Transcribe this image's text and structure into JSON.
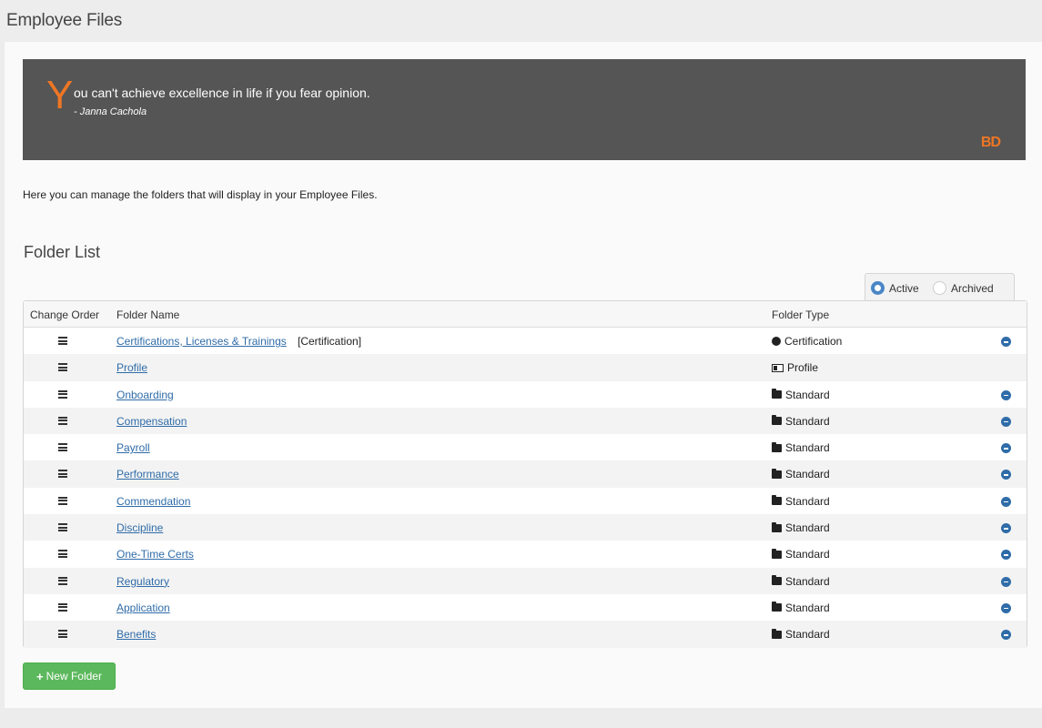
{
  "page": {
    "title": "Employee Files"
  },
  "quote": {
    "first_letter": "Y",
    "text": "ou can't achieve excellence in life if you fear opinion.",
    "author": "- Janna Cachola",
    "logo": "BD"
  },
  "intro": "Here you can manage the folders that will display in your Employee Files.",
  "section_title": "Folder List",
  "filter": {
    "active_label": "Active",
    "archived_label": "Archived",
    "selected": "Active"
  },
  "table": {
    "headers": {
      "order": "Change Order",
      "name": "Folder Name",
      "type": "Folder Type"
    },
    "rows": [
      {
        "name": "Certifications, Licenses & Trainings",
        "suffix": "[Certification]",
        "type": "Certification",
        "icon": "certificate-icon",
        "removable": true
      },
      {
        "name": "Profile",
        "suffix": "",
        "type": "Profile",
        "icon": "id-card-icon",
        "removable": false
      },
      {
        "name": "Onboarding",
        "suffix": "",
        "type": "Standard",
        "icon": "folder-icon",
        "removable": true
      },
      {
        "name": "Compensation",
        "suffix": "",
        "type": "Standard",
        "icon": "folder-icon",
        "removable": true
      },
      {
        "name": "Payroll",
        "suffix": "",
        "type": "Standard",
        "icon": "folder-icon",
        "removable": true
      },
      {
        "name": "Performance",
        "suffix": "",
        "type": "Standard",
        "icon": "folder-icon",
        "removable": true
      },
      {
        "name": "Commendation",
        "suffix": "",
        "type": "Standard",
        "icon": "folder-icon",
        "removable": true
      },
      {
        "name": "Discipline",
        "suffix": "",
        "type": "Standard",
        "icon": "folder-icon",
        "removable": true
      },
      {
        "name": "One-Time Certs",
        "suffix": "",
        "type": "Standard",
        "icon": "folder-icon",
        "removable": true
      },
      {
        "name": "Regulatory",
        "suffix": "",
        "type": "Standard",
        "icon": "folder-icon",
        "removable": true
      },
      {
        "name": "Application",
        "suffix": "",
        "type": "Standard",
        "icon": "folder-icon",
        "removable": true
      },
      {
        "name": "Benefits",
        "suffix": "",
        "type": "Standard",
        "icon": "folder-icon",
        "removable": true
      }
    ]
  },
  "new_folder_button": {
    "icon": "plus-icon",
    "label": "New Folder"
  },
  "colors": {
    "accent": "#ee7624",
    "link": "#2f6ca8",
    "success": "#5cb85c",
    "quote_bg": "#555555"
  }
}
